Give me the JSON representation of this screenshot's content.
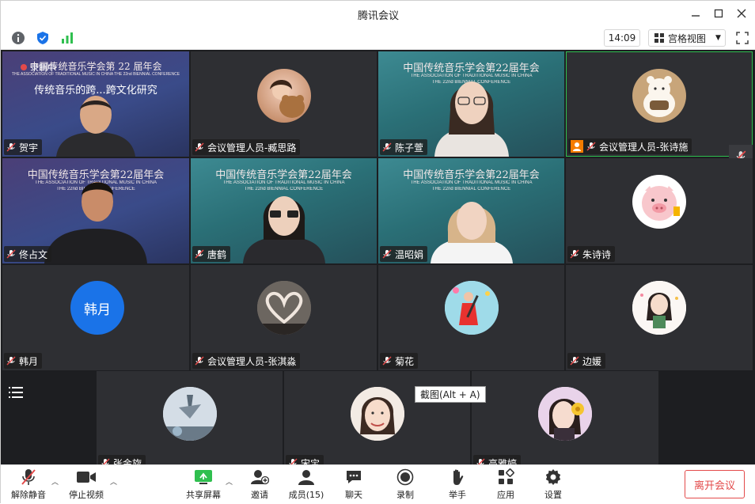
{
  "window": {
    "title": "腾讯会议"
  },
  "subbar": {
    "time": "14:09",
    "view_label": "宫格视图"
  },
  "slide": {
    "title_a": "中国传统音乐学会第 22 届年会",
    "title_b": "中国传统音乐学会第22届年会",
    "subtitle_en": "THE ASSOCIATION OF TRADITIONAL MUSIC IN CHINA THE 22nd BIENNIAL CONFERENCE",
    "line_en1": "THE ASSOCIATION OF TRADITIONAL MUSIC IN CHINA",
    "line_en2": "THE 22nd BIENNIAL CONFERENCE",
    "topic": "传统音乐的跨...跨文化研究",
    "recording": "录制中"
  },
  "participants": [
    {
      "name": "贺宇"
    },
    {
      "name": "会议管理人员-臧思路"
    },
    {
      "name": "陈子萱"
    },
    {
      "name": "会议管理人员-张诗施"
    },
    {
      "name": "佟占文"
    },
    {
      "name": "唐鹤"
    },
    {
      "name": "温昭娟"
    },
    {
      "name": "朱诗诗"
    },
    {
      "name": "韩月",
      "avatar_text": "韩月"
    },
    {
      "name": "会议管理人员-张淇淼"
    },
    {
      "name": "菊花"
    },
    {
      "name": "边媛"
    },
    {
      "name": "张金旋"
    },
    {
      "name": "宋宝"
    },
    {
      "name": "高雅婷"
    }
  ],
  "tooltip": "截图(Alt + A)",
  "toolbar": {
    "unmute": "解除静音",
    "stop_video": "停止视频",
    "share": "共享屏幕",
    "invite": "邀请",
    "members": "成员(15)",
    "chat": "聊天",
    "record": "录制",
    "raise_hand": "举手",
    "apps": "应用",
    "settings": "设置",
    "leave": "离开会议"
  },
  "colors": {
    "accent": "#1a73e8",
    "leave": "#e34a4a",
    "active_border": "#2fbf4f",
    "tile_bg": "#2e2f33"
  }
}
